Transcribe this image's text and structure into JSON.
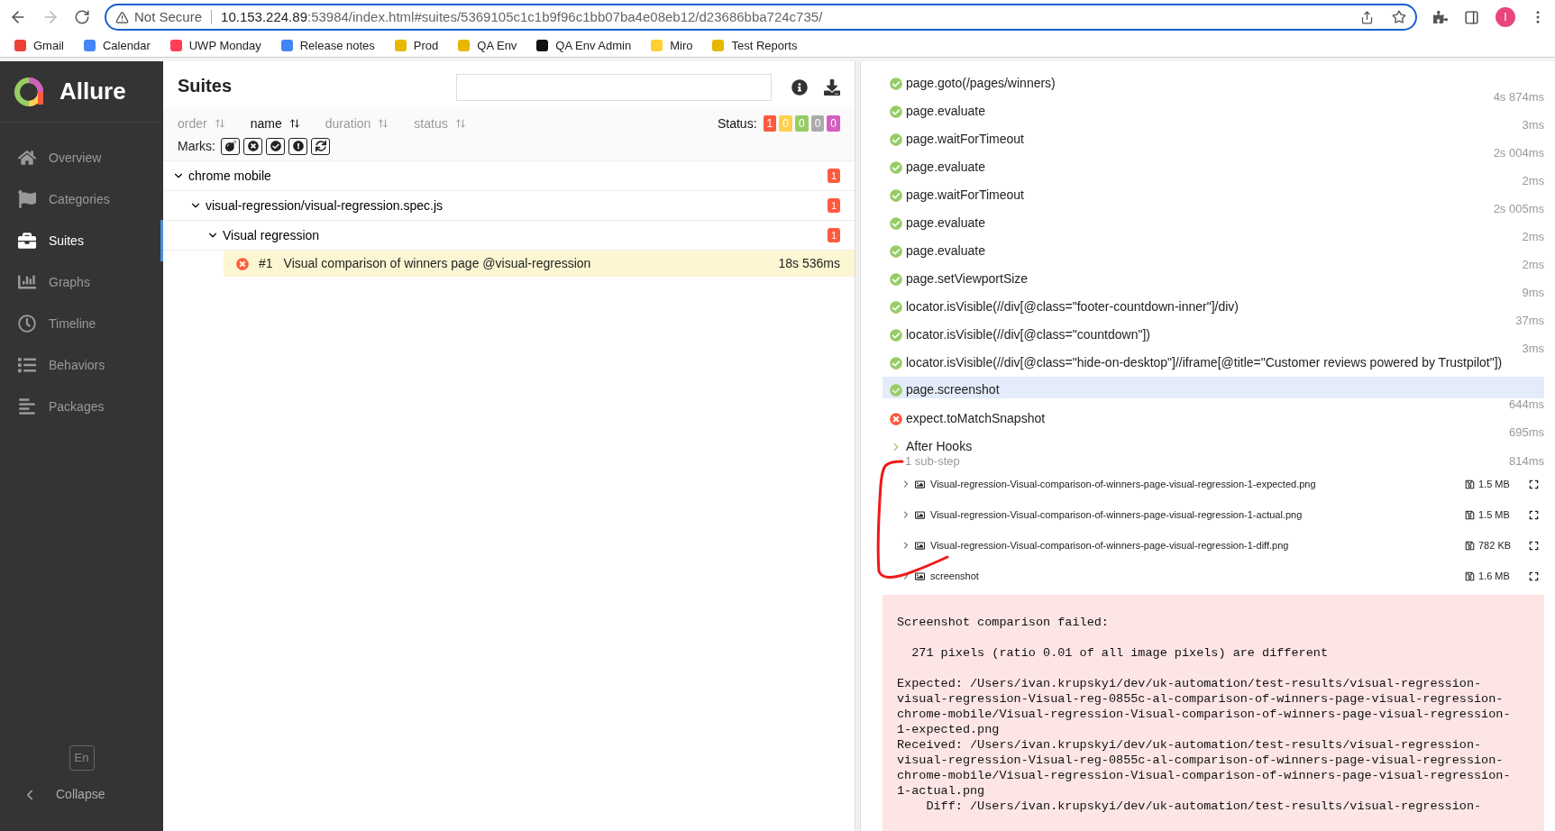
{
  "browser": {
    "security": "Not Secure",
    "url_host": "10.153.224.89",
    "url_rest": ":53984/index.html#suites/5369105c1c1b9f96c1bb07ba4e08eb12/d23686bba724c735/",
    "profile": "I",
    "bookmarks": [
      "Gmail",
      "Calendar",
      "UWP Monday",
      "Release notes",
      "Prod",
      "QA Env",
      "QA Env Admin",
      "Miro",
      "Test Reports"
    ]
  },
  "sidebar": {
    "logo": "Allure",
    "items": [
      {
        "label": "Overview",
        "selected": false
      },
      {
        "label": "Categories",
        "selected": false
      },
      {
        "label": "Suites",
        "selected": true
      },
      {
        "label": "Graphs",
        "selected": false
      },
      {
        "label": "Timeline",
        "selected": false
      },
      {
        "label": "Behaviors",
        "selected": false
      },
      {
        "label": "Packages",
        "selected": false
      }
    ],
    "language": "En",
    "collapse": "Collapse"
  },
  "suites": {
    "title": "Suites",
    "sort": [
      {
        "label": "order",
        "selected": false
      },
      {
        "label": "name",
        "selected": true
      },
      {
        "label": "duration",
        "selected": false
      },
      {
        "label": "status",
        "selected": false
      }
    ],
    "status_label": "Status:",
    "status_counts": [
      {
        "count": "1",
        "color": "#fd5a3e"
      },
      {
        "count": "0",
        "color": "#ffd050"
      },
      {
        "count": "0",
        "color": "#97cc64"
      },
      {
        "count": "0",
        "color": "#aaaaaa"
      },
      {
        "count": "0",
        "color": "#d35ebe"
      }
    ],
    "marks_label": "Marks:",
    "tree": [
      {
        "name": "chrome mobile",
        "count": "1",
        "expanded": true,
        "children": [
          {
            "name": "visual-regression/visual-regression.spec.js",
            "count": "1",
            "expanded": true,
            "children": [
              {
                "name": "Visual regression",
                "count": "1",
                "expanded": true,
                "tests": [
                  {
                    "number": "#1",
                    "name": "Visual comparison of winners page @visual-regression",
                    "duration": "18s 536ms",
                    "kind": "failed",
                    "selected": true
                  }
                ]
              }
            ]
          }
        ]
      }
    ]
  },
  "steps": [
    {
      "name": "page.goto(/pages/winners)",
      "duration": "4s 874ms",
      "kind": "passed",
      "selected": false
    },
    {
      "name": "page.evaluate",
      "duration": "3ms",
      "kind": "passed",
      "selected": false
    },
    {
      "name": "page.waitForTimeout",
      "duration": "2s 004ms",
      "kind": "passed",
      "selected": false
    },
    {
      "name": "page.evaluate",
      "duration": "2ms",
      "kind": "passed",
      "selected": false
    },
    {
      "name": "page.waitForTimeout",
      "duration": "2s 005ms",
      "kind": "passed",
      "selected": false
    },
    {
      "name": "page.evaluate",
      "duration": "2ms",
      "kind": "passed",
      "selected": false
    },
    {
      "name": "page.evaluate",
      "duration": "2ms",
      "kind": "passed",
      "selected": false
    },
    {
      "name": "page.setViewportSize",
      "duration": "9ms",
      "kind": "passed",
      "selected": false
    },
    {
      "name": "locator.isVisible(//div[@class=\"footer-countdown-inner\"]/div)",
      "duration": "37ms",
      "kind": "passed",
      "selected": false
    },
    {
      "name": "locator.isVisible(//div[@class=\"countdown\"])",
      "duration": "3ms",
      "kind": "passed",
      "selected": false
    },
    {
      "name": "locator.isVisible(//div[@class=\"hide-on-desktop\"]//iframe[@title=\"Customer reviews powered by Trustpilot\"])",
      "kind": "passed",
      "selected": false
    },
    {
      "name": "page.screenshot",
      "duration": "644ms",
      "kind": "passed",
      "selected": true
    },
    {
      "name": "expect.toMatchSnapshot",
      "duration": "695ms",
      "kind": "failed",
      "selected": false
    }
  ],
  "after_hooks": {
    "label": "After Hooks",
    "substeps": "1 sub-step",
    "duration": "814ms",
    "attachments": [
      {
        "name": "Visual-regression-Visual-comparison-of-winners-page-visual-regression-1-expected.png",
        "size": "1.5 MB",
        "expanded": false
      },
      {
        "name": "Visual-regression-Visual-comparison-of-winners-page-visual-regression-1-actual.png",
        "size": "1.5 MB",
        "expanded": false
      },
      {
        "name": "Visual-regression-Visual-comparison-of-winners-page-visual-regression-1-diff.png",
        "size": "782 KB",
        "expanded": false
      },
      {
        "name": "screenshot",
        "size": "1.6 MB",
        "expanded": false
      }
    ]
  },
  "error_paragraphs": [
    [
      "Screenshot comparison failed:"
    ],
    [
      "  271 pixels (ratio 0.01 of all image pixels) are different"
    ],
    [
      "Expected: /Users/ivan.krupskyi/dev/uk-automation/test-results/visual-regression-",
      "visual-regression-Visual-reg-0855c-al-comparison-of-winners-page-visual-regression-",
      "chrome-mobile/Visual-regression-Visual-comparison-of-winners-page-visual-regression-",
      "1-expected.png",
      "Received: /Users/ivan.krupskyi/dev/uk-automation/test-results/visual-regression-",
      "visual-regression-Visual-reg-0855c-al-comparison-of-winners-page-visual-regression-",
      "chrome-mobile/Visual-regression-Visual-comparison-of-winners-page-visual-regression-",
      "1-actual.png",
      "    Diff: /Users/ivan.krupskyi/dev/uk-automation/test-results/visual-regression-"
    ]
  ]
}
